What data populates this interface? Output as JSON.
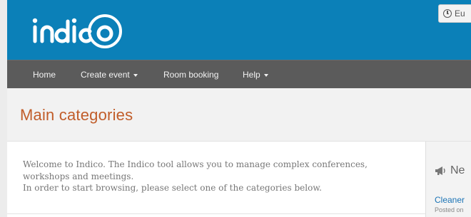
{
  "brand": {
    "logo_text": "indico",
    "header_color": "#0b80b8",
    "navbar_color": "#5b5b5b",
    "title_color": "#c15d2a"
  },
  "header": {
    "timezone_button_label": "Eu",
    "timezone_icon": "clock-icon"
  },
  "nav": {
    "items": [
      {
        "label": "Home",
        "dropdown": false
      },
      {
        "label": "Create event",
        "dropdown": true
      },
      {
        "label": "Room booking",
        "dropdown": false
      },
      {
        "label": "Help",
        "dropdown": true
      }
    ]
  },
  "main": {
    "title": "Main categories",
    "welcome_line1": "Welcome to Indico. The Indico tool allows you to manage complex conferences,",
    "welcome_line2": "workshops and meetings.",
    "welcome_line3": "In order to start browsing, please select one of the categories below."
  },
  "news": {
    "icon": "megaphone-icon",
    "heading": "Ne",
    "item_title": "Cleaner",
    "item_meta": "Posted on"
  }
}
